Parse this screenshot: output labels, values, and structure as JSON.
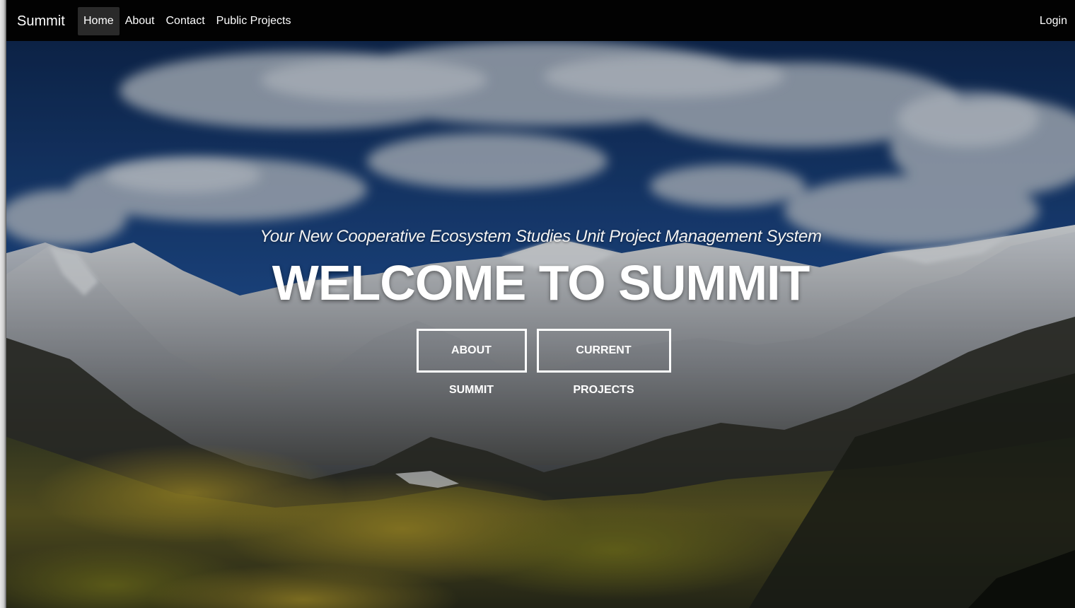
{
  "nav": {
    "brand": "Summit",
    "items": [
      {
        "label": "Home",
        "active": true
      },
      {
        "label": "About",
        "active": false
      },
      {
        "label": "Contact",
        "active": false
      },
      {
        "label": "Public Projects",
        "active": false
      }
    ],
    "login_label": "Login"
  },
  "hero": {
    "tagline": "Your New Cooperative Ecosystem Studies Unit Project Management System",
    "headline": "WELCOME TO SUMMIT",
    "buttons": [
      {
        "label": "About Summit"
      },
      {
        "label": "Current Projects"
      }
    ],
    "background_image": "mountain-landscape"
  },
  "colors": {
    "navbar_bg": "#020202",
    "nav_active_bg": "#2a2a2a",
    "text": "#ffffff",
    "sky": "#1f4e92",
    "snow": "#d9dde2",
    "forest": "#2c3522",
    "aspen": "#9a8a24"
  }
}
